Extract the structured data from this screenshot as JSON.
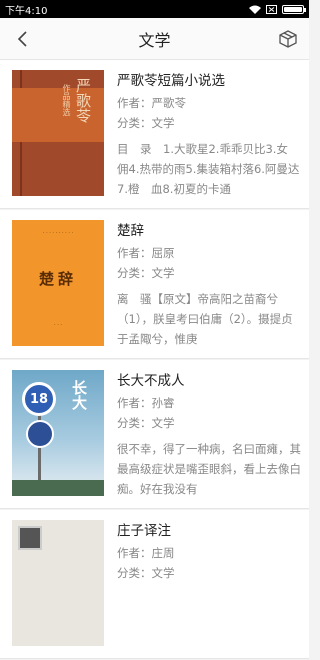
{
  "status": {
    "time": "下午4:10"
  },
  "header": {
    "title": "文学",
    "back_icon": "chevron-left-icon",
    "action_icon": "box-icon"
  },
  "books": [
    {
      "title": "严歌苓短篇小说选",
      "author": "作者：严歌苓",
      "category": "分类：文学",
      "summary": "目　录　1.大歌星2.乖乖贝比3.女　佣4.热带的雨5.集装箱村落6.阿曼达7.橙　血8.初夏的卡通",
      "cover": {
        "v1": "严歌苓",
        "v2": "作品精选"
      }
    },
    {
      "title": "楚辞",
      "author": "作者：屈原",
      "category": "分类：文学",
      "summary": "离　骚【原文】帝高阳之苗裔兮（1），朕皇考曰伯庸（2）。摄提贞于孟陬兮，惟庚",
      "cover": {
        "name": "楚辞"
      }
    },
    {
      "title": "长大不成人",
      "author": "作者：孙睿",
      "category": "分类：文学",
      "summary": "很不幸，得了一种病，名曰面瘫，其最高级症状是嘴歪眼斜，看上去像白痴。好在我没有",
      "cover": {
        "sign": "18",
        "vt": "长大"
      }
    },
    {
      "title": "庄子译注",
      "author": "作者：庄周",
      "category": "分类：文学",
      "summary": "",
      "cover": {}
    }
  ]
}
